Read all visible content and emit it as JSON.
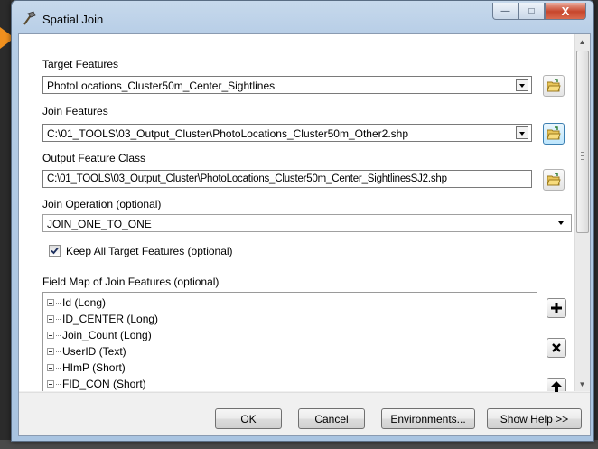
{
  "window": {
    "title": "Spatial Join",
    "controls": {
      "minimize": "—",
      "maximize": "□",
      "close": "X"
    }
  },
  "form": {
    "target_features": {
      "label": "Target Features",
      "value": "PhotoLocations_Cluster50m_Center_Sightlines"
    },
    "join_features": {
      "label": "Join Features",
      "value": "C:\\01_TOOLS\\03_Output_Cluster\\PhotoLocations_Cluster50m_Other2.shp"
    },
    "output_feature_class": {
      "label": "Output Feature Class",
      "value": "C:\\01_TOOLS\\03_Output_Cluster\\PhotoLocations_Cluster50m_Center_SightlinesSJ2.shp"
    },
    "join_operation": {
      "label": "Join Operation (optional)",
      "value": "JOIN_ONE_TO_ONE"
    },
    "keep_all": {
      "label": "Keep All Target Features (optional)",
      "checked": true
    },
    "field_map": {
      "label": "Field Map of Join Features (optional)",
      "items": [
        "Id (Long)",
        "ID_CENTER (Long)",
        "Join_Count (Long)",
        "UserID (Text)",
        "HImP (Short)",
        "FID_CON (Short)"
      ]
    }
  },
  "footer": {
    "ok": "OK",
    "cancel": "Cancel",
    "environments": "Environments...",
    "show_help": "Show Help >>"
  },
  "colors": {
    "accent": "#f0901e",
    "titlebar": "#b6cde6",
    "close_button": "#c7462c"
  }
}
